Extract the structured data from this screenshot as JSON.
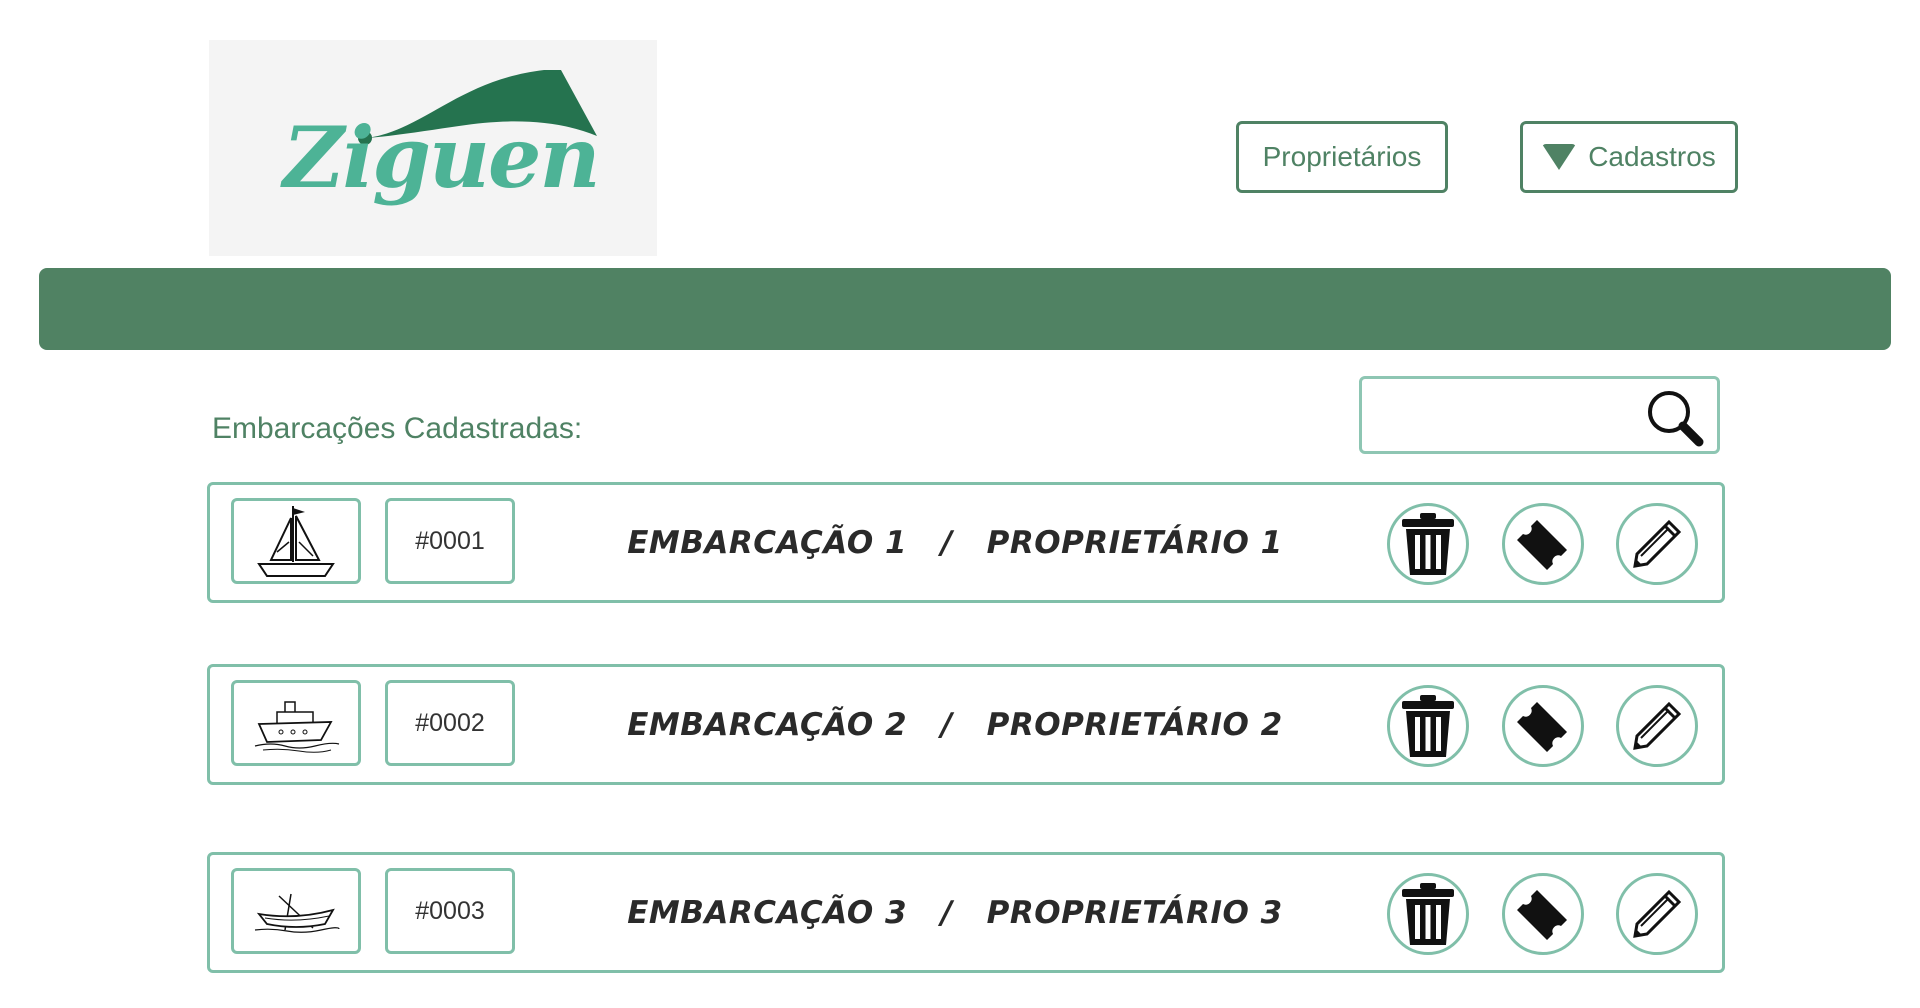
{
  "brand": {
    "name": "Ziguen"
  },
  "nav": {
    "owners_label": "Proprietários",
    "registrations_label": "Cadastros"
  },
  "section": {
    "title": "Embarcações Cadastradas:"
  },
  "search": {
    "value": "",
    "placeholder": ""
  },
  "colors": {
    "primary": "#508263",
    "accent": "#4db396",
    "border": "#80bfa9"
  },
  "rows": [
    {
      "id": "#0001",
      "title": "EMBARCAÇÃO 1   /   PROPRIETÁRIO 1",
      "icon": "sailboat-icon"
    },
    {
      "id": "#0002",
      "title": "EMBARCAÇÃO 2   /   PROPRIETÁRIO 2",
      "icon": "ship-icon"
    },
    {
      "id": "#0003",
      "title": "EMBARCAÇÃO 3   /   PROPRIETÁRIO 3",
      "icon": "rowboat-icon"
    }
  ],
  "row_actions": [
    "trash-icon",
    "ticket-icon",
    "pencil-icon"
  ]
}
